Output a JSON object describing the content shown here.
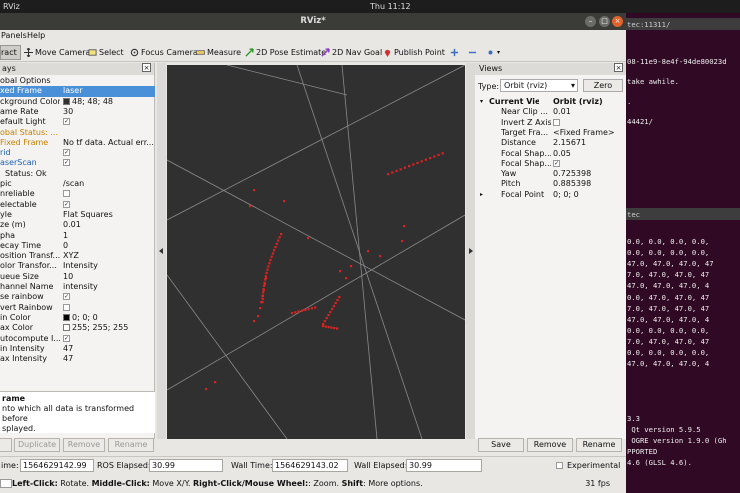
{
  "os": {
    "app_menu": "RViz",
    "clock": "Thu 11:12"
  },
  "window": {
    "title": "RViz*",
    "menu": [
      "Panels",
      "Help"
    ]
  },
  "toolbar": {
    "interact": "ract",
    "move_camera": "Move Camera",
    "select": "Select",
    "focus_camera": "Focus Camera",
    "measure": "Measure",
    "pose_estimate": "2D Pose Estimate",
    "nav_goal": "2D Nav Goal",
    "publish_point": "Publish Point"
  },
  "displays": {
    "title": "ays",
    "rows": [
      {
        "k": "obal Options",
        "v": ""
      },
      {
        "k": "xed Frame",
        "v": "laser"
      },
      {
        "k": "ckground Color",
        "v": "48; 48; 48"
      },
      {
        "k": "ame Rate",
        "v": "30"
      },
      {
        "k": "efault Light",
        "v": ""
      },
      {
        "k": "obal Status: ...",
        "v": ""
      },
      {
        "k": "Fixed Frame",
        "v": "No tf data.  Actual err..."
      },
      {
        "k": "rid",
        "v": ""
      },
      {
        "k": "aserScan",
        "v": ""
      },
      {
        "k": "Status: Ok",
        "v": ""
      },
      {
        "k": "pic",
        "v": "/scan"
      },
      {
        "k": "nreliable",
        "v": ""
      },
      {
        "k": "electable",
        "v": ""
      },
      {
        "k": "yle",
        "v": "Flat Squares"
      },
      {
        "k": "ze (m)",
        "v": "0.01"
      },
      {
        "k": "pha",
        "v": "1"
      },
      {
        "k": "ecay Time",
        "v": "0"
      },
      {
        "k": "osition Transf...",
        "v": "XYZ"
      },
      {
        "k": "olor Transfor...",
        "v": "Intensity"
      },
      {
        "k": "ueue Size",
        "v": "10"
      },
      {
        "k": "hannel Name",
        "v": "intensity"
      },
      {
        "k": "se rainbow",
        "v": ""
      },
      {
        "k": "vert Rainbow",
        "v": ""
      },
      {
        "k": "in Color",
        "v": "0; 0; 0"
      },
      {
        "k": "ax Color",
        "v": "255; 255; 255"
      },
      {
        "k": "utocompute I...",
        "v": ""
      },
      {
        "k": "in Intensity",
        "v": "47"
      },
      {
        "k": "ax Intensity",
        "v": "47"
      }
    ],
    "desc_title": "rame",
    "desc_line1": "nto which all data is transformed before",
    "desc_line2": "splayed.",
    "buttons": [
      "",
      "Duplicate",
      "Remove",
      "Rename"
    ]
  },
  "views": {
    "title": "Views",
    "type_label": "Type:",
    "type_value": "Orbit (rviz)",
    "zero": "Zero",
    "rows": [
      {
        "k": "Current View",
        "v": "Orbit (rviz)"
      },
      {
        "k": "Near Clip ...",
        "v": "0.01"
      },
      {
        "k": "Invert Z Axis",
        "v": ""
      },
      {
        "k": "Target Fra...",
        "v": "<Fixed Frame>"
      },
      {
        "k": "Distance",
        "v": "2.15671"
      },
      {
        "k": "Focal Shap...",
        "v": "0.05"
      },
      {
        "k": "Focal Shap...",
        "v": ""
      },
      {
        "k": "Yaw",
        "v": "0.725398"
      },
      {
        "k": "Pitch",
        "v": "0.885398"
      },
      {
        "k": "Focal Point",
        "v": "0; 0; 0"
      }
    ],
    "buttons": [
      "Save",
      "Remove",
      "Rename"
    ]
  },
  "time": {
    "ros_time_label": "ime:",
    "ros_time": "1564629142.99",
    "ros_elapsed_label": "ROS Elapsed:",
    "ros_elapsed": "30.99",
    "wall_time_label": "Wall Time:",
    "wall_time": "1564629143.02",
    "wall_elapsed_label": "Wall Elapsed:",
    "wall_elapsed": "30.99",
    "experimental": "Experimental"
  },
  "status": {
    "left_label": "Left-Click:",
    "left_text": " Rotate. ",
    "middle_label": "Middle-Click:",
    "middle_text": " Move X/Y. ",
    "right_label": "Right-Click/Mouse Wheel:",
    "right_text": ": Zoom. ",
    "shift_label": "Shift",
    "shift_text": ": More options.",
    "fps": "31 fps"
  },
  "terminal": {
    "tab1": "tec:11311/",
    "l1": "08-11e9-8e4f-94de80023d",
    "l2": "take awhile.",
    "l3": ".",
    "l4": "44421/",
    "tab2": "tec",
    "data_lines": [
      "0.0, 0.0, 0.0, 0.0,",
      "0.0, 0.0, 0.0, 0.0,",
      "47.0, 47.0, 47.0, 47",
      "7.0, 47.0, 47.0, 47",
      "47.0, 47.0, 47.0, 4",
      "0.0, 47.0, 47.0, 47",
      "7.0, 47.0, 47.0, 47",
      "47.0, 47.0, 47.0, 4",
      "0.0, 0.0, 0.0, 0.0,",
      "7.0, 47.0, 47.0, 47",
      "0.0, 0.0, 0.0, 0.0,",
      "47.0, 47.0, 47.0, 4"
    ],
    "v1": "3.3",
    "v2": " Qt version 5.9.5",
    "v3": " OGRE version 1.9.0 (Gh",
    "v4": "PPORTED",
    "v5": "4.6 (GLSL 4.6)."
  },
  "colors": {
    "laser_points": "#e02020",
    "background_swatch": "#303030",
    "selection": "#4a90d9",
    "terminal_bg": "#300a24"
  }
}
